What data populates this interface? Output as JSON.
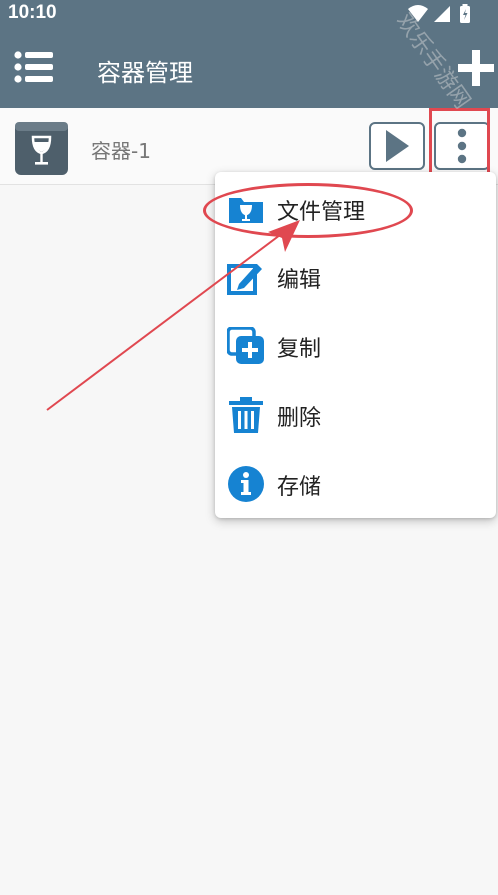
{
  "status_bar": {
    "time": "10:10",
    "icons": [
      "wifi-icon",
      "signal-icon",
      "battery-icon"
    ]
  },
  "app_bar": {
    "title": "容器管理",
    "menu_icon": "menu-list-icon",
    "add_icon": "plus-icon"
  },
  "container_list": [
    {
      "name": "容器-1",
      "icon": "wine-glass-box-icon",
      "actions": [
        "play-icon",
        "more-vert-icon"
      ]
    }
  ],
  "popup_menu": {
    "items": [
      {
        "label": "文件管理",
        "icon": "folder-wine-icon"
      },
      {
        "label": "编辑",
        "icon": "edit-icon"
      },
      {
        "label": "复制",
        "icon": "copy-add-icon"
      },
      {
        "label": "删除",
        "icon": "trash-icon"
      },
      {
        "label": "存储",
        "icon": "info-icon"
      }
    ]
  },
  "watermark": "欢乐手游网",
  "colors": {
    "primary": "#5c7484",
    "icon_blue": "#1683d2",
    "highlight": "#e04850",
    "background": "#f7f7f7"
  }
}
